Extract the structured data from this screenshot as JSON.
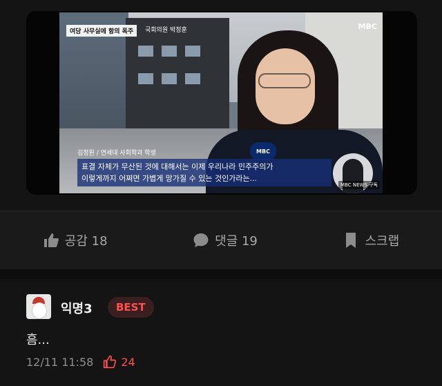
{
  "video": {
    "topic_caption": "여당 사무실에 항의 폭주",
    "office_sign": "국회의원 박정훈",
    "broadcaster_logo": "MBC",
    "interviewee": "김정원 / 연세대 사회학과 학생",
    "subtitle_line1": "표결 자체가 무산된 것에 대해서는 이제 우리나라 민주주의가",
    "subtitle_line2": "이렇게까지 어쩌면 가볍게 망가질 수 있는 것인가라는...",
    "mic_label": "MBC",
    "corner_badge": "MBC NEWS 구독"
  },
  "actions": {
    "like_label": "공감 18",
    "comment_label": "댓글 19",
    "scrap_label": "스크랩"
  },
  "comment": {
    "username": "익명3",
    "badge": "BEST",
    "text": "흠...",
    "timestamp": "12/11 11:58",
    "likes": "24"
  },
  "colors": {
    "background": "#141414",
    "accent_red": "#ff4f4f"
  }
}
